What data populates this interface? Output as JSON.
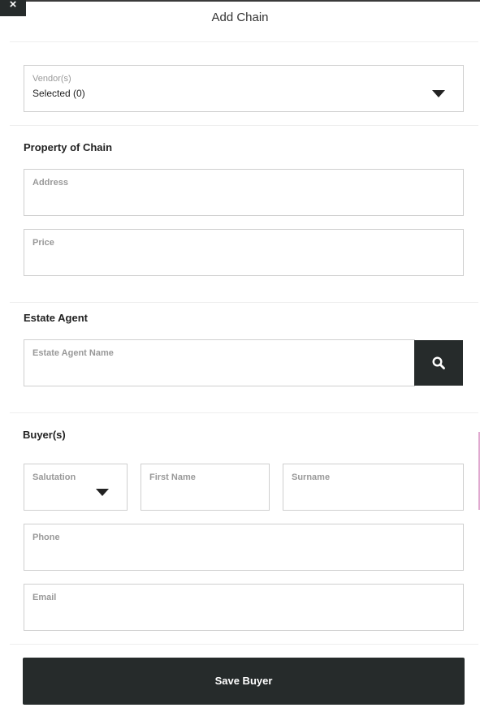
{
  "header": {
    "close_symbol": "×",
    "title": "Add Chain"
  },
  "vendors": {
    "label": "Vendor(s)",
    "value": "Selected (0)"
  },
  "property": {
    "heading": "Property of Chain",
    "address_label": "Address",
    "price_label": "Price"
  },
  "estate_agent": {
    "heading": "Estate Agent",
    "name_label": "Estate Agent Name"
  },
  "buyers": {
    "heading": "Buyer(s)",
    "salutation_label": "Salutation",
    "first_name_label": "First Name",
    "surname_label": "Surname",
    "phone_label": "Phone",
    "email_label": "Email"
  },
  "footer": {
    "save_label": "Save Buyer"
  },
  "colors": {
    "dark": "#262b2b",
    "border": "#cfcfcf",
    "label": "#999999"
  },
  "icons": [
    "close-icon",
    "chevron-down-icon",
    "search-icon"
  ]
}
